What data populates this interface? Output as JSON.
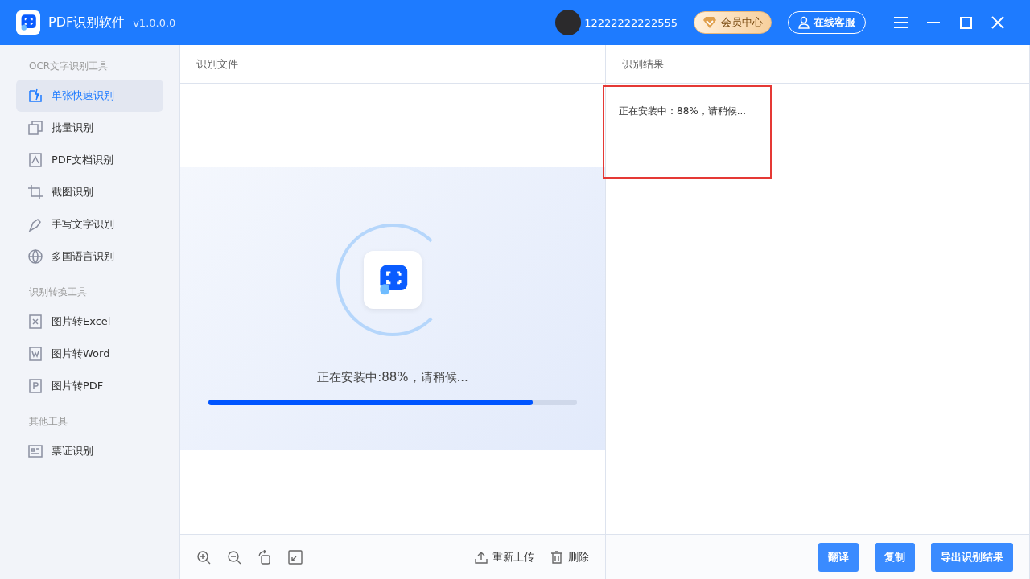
{
  "app": {
    "title": "PDF识别软件",
    "version": "v1.0.0.0"
  },
  "header": {
    "username": "12222222222555",
    "vip_button": "会员中心",
    "service_button": "在线客服"
  },
  "sidebar": {
    "sections": [
      {
        "title": "OCR文字识别工具",
        "items": [
          {
            "label": "单张快速识别",
            "selected": true
          },
          {
            "label": "批量识别",
            "selected": false
          },
          {
            "label": "PDF文档识别",
            "selected": false
          },
          {
            "label": "截图识别",
            "selected": false
          },
          {
            "label": "手写文字识别",
            "selected": false
          },
          {
            "label": "多国语言识别",
            "selected": false
          }
        ]
      },
      {
        "title": "识别转换工具",
        "items": [
          {
            "label": "图片转Excel",
            "selected": false
          },
          {
            "label": "图片转Word",
            "selected": false
          },
          {
            "label": "图片转PDF",
            "selected": false
          }
        ]
      },
      {
        "title": "其他工具",
        "items": [
          {
            "label": "票证识别",
            "selected": false
          }
        ]
      }
    ]
  },
  "file_panel": {
    "title": "识别文件",
    "status": "正在安装中:88%，请稍候...",
    "level": 0.88,
    "actions": [
      "重新上传",
      "删除"
    ]
  },
  "result_panel": {
    "title": "识别结果",
    "text": "正在安装中：88%，请稍候...",
    "buttons": [
      "翻译",
      "复制",
      "导出识别结果"
    ]
  }
}
